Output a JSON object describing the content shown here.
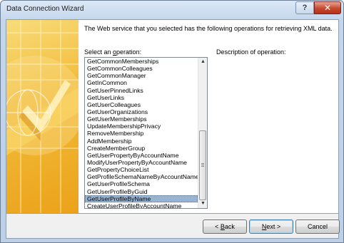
{
  "window": {
    "title": "Data Connection Wizard",
    "help_label": "?",
    "close_label": "✕"
  },
  "main": {
    "intro_text": "The Web service that you selected has the following operations for retrieving XML data.",
    "select_label_before": "Select an ",
    "select_label_accel": "o",
    "select_label_after": "peration:",
    "description_label": "Description of operation:",
    "operations": [
      "GetCommonMemberships",
      "GetCommonColleagues",
      "GetCommonManager",
      "GetInCommon",
      "GetUserPinnedLinks",
      "GetUserLinks",
      "GetUserColleagues",
      "GetUserOrganizations",
      "GetUserMemberships",
      "UpdateMembershipPrivacy",
      "RemoveMembership",
      "AddMembership",
      "CreateMemberGroup",
      "GetUserPropertyByAccountName",
      "ModifyUserPropertyByAccountName",
      "GetPropertyChoiceList",
      "GetProfileSchemaNameByAccountName",
      "GetUserProfileSchema",
      "GetUserProfileByGuid",
      "GetUserProfileByName",
      "CreateUserProfileByAccountName"
    ],
    "selected_operation": "GetUserProfileByName"
  },
  "footer": {
    "back_prefix": "< ",
    "back_accel": "B",
    "back_rest": "ack",
    "next_accel": "N",
    "next_rest": "ext >",
    "cancel_label": "Cancel"
  },
  "colors": {
    "banner_gold": "#f2bd3b",
    "selection": "#99b4d1",
    "close_red": "#c7482e"
  }
}
